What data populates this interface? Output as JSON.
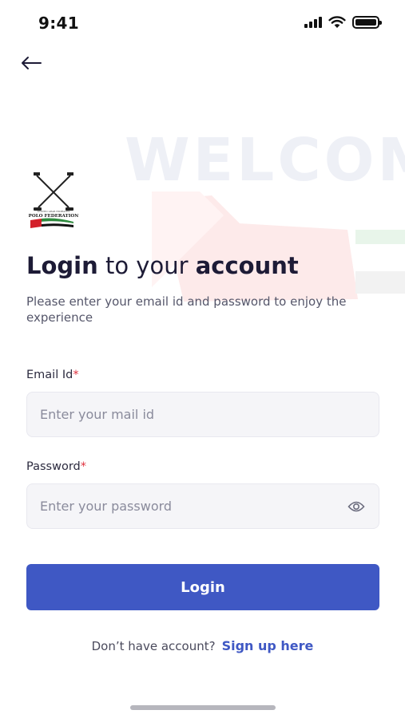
{
  "status_bar": {
    "time": "9:41"
  },
  "background": {
    "watermark": "WELCOM"
  },
  "logo": {
    "line1": "UNITED ARAB EMIRATES",
    "line2": "POLO FEDERATION"
  },
  "headline": {
    "bold1": "Login",
    "middle": " to your ",
    "bold2": "account"
  },
  "subtitle": "Please enter your email id and password to enjoy the experience",
  "form": {
    "email": {
      "label": "Email Id",
      "required": "*",
      "placeholder": "Enter your mail id",
      "value": ""
    },
    "password": {
      "label": "Password",
      "required": "*",
      "placeholder": "Enter your password",
      "value": ""
    },
    "submit_label": "Login"
  },
  "signup": {
    "prompt": "Don’t have account?",
    "link": "Sign up here"
  },
  "icons": {
    "back": "arrow-left-icon",
    "eye": "eye-icon",
    "signal": "cellular-signal-icon",
    "wifi": "wifi-icon",
    "battery": "battery-icon"
  },
  "colors": {
    "primary": "#3f58c4",
    "required": "#e0313e",
    "input_bg": "#f5f5f8",
    "text_dark": "#1d1b36"
  }
}
